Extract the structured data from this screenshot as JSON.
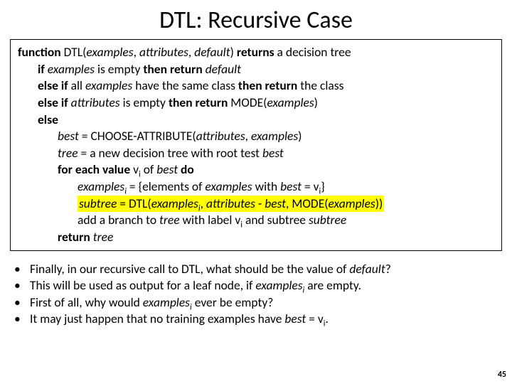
{
  "title": "DTL: Recursive Case",
  "code": {
    "l1": {
      "kw_function": "function",
      "fname": " DTL(",
      "a1": "examples",
      "c1": ", ",
      "a2": "attributes",
      "c2": ", ",
      "a3": "default",
      "rp": ") ",
      "kw_returns": "returns",
      "tail": " a decision tree"
    },
    "l2": {
      "kw_if": "if ",
      "v": "examples",
      "mid": " is empty ",
      "kw_then": "then return ",
      "d": "default"
    },
    "l3": {
      "kw": "else if ",
      "t1": "all ",
      "v": "examples",
      "t2": " have the same class ",
      "kw2": "then return",
      "t3": " the class"
    },
    "l4": {
      "kw": "else if ",
      "v": "attributes",
      "t1": " is empty ",
      "kw2": "then return",
      "t2": " MODE(",
      "v2": "examples",
      "rp": ")"
    },
    "l5": {
      "kw": "else"
    },
    "l6": {
      "v": "best",
      "eq": " = CHOOSE-ATTRIBUTE(",
      "a1": "attributes",
      "c": ", ",
      "a2": "examples",
      "rp": ")"
    },
    "l7": {
      "v": "tree",
      "t": " = a new decision tree with root test ",
      "v2": "best"
    },
    "l8": {
      "kw": "for each value",
      "t1": " v",
      "sub": "i",
      "t2": " of ",
      "v": "best",
      "kw2": " do"
    },
    "l9": {
      "v": "examples",
      "sub": "i",
      "eq": " = {elements of ",
      "v2": "examples",
      "t": " with ",
      "v3": "best",
      "eq2": " = v",
      "sub2": "i",
      "rb": "}"
    },
    "l10": {
      "v": "subtree",
      "eq": " = DTL(",
      "a1": "examples",
      "sub": "i",
      "c1": ", ",
      "a2": "attributes",
      "m": " - ",
      "a3": "best",
      "c2": ", ",
      "mo": "MODE(",
      "a4": "examples",
      "rp": "))"
    },
    "l11": {
      "t1": "add a branch to ",
      "v1": "tree",
      "t2": " with label v",
      "sub": "i",
      "t3": " and subtree ",
      "v2": "subtree"
    },
    "l12": {
      "kw": "return ",
      "v": "tree"
    }
  },
  "bullets": [
    {
      "pre": "Finally, in our recursive call to DTL, what should be the value of ",
      "em": "default",
      "post": "?"
    },
    {
      "pre": "This will be used as output for a leaf node, if ",
      "em": "examples",
      "sub": "i",
      "post": " are empty."
    },
    {
      "pre": "First of all, why would ",
      "em": "examples",
      "sub": "i",
      "post": " ever be empty?"
    },
    {
      "pre": "It may just happen that no training examples have ",
      "em": "best",
      "post_plain": " = v",
      "sub2": "i",
      "post": "."
    }
  ],
  "pagenum": "45"
}
